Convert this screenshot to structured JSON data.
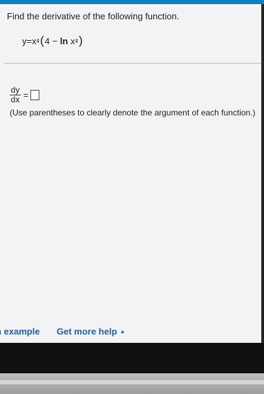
{
  "question": {
    "prompt": "Find the derivative of the following function.",
    "function": {
      "lhs": "y",
      "eq": "=",
      "base": "x",
      "exp1": "4",
      "open_paren": "(",
      "inner_const": "4",
      "minus": "−",
      "ln": "ln",
      "inner_base": "x",
      "exp2": "4",
      "close_paren": ")"
    }
  },
  "answer": {
    "numerator": "dy",
    "denominator": "dx",
    "equals": "=",
    "value": ""
  },
  "hint": "(Use parentheses to clearly denote the argument of each function.)",
  "footer": {
    "example_link": "n example",
    "help_link": "Get more help",
    "help_caret": "▲"
  },
  "colors": {
    "accent_bar": "#0f7fc0",
    "link": "#1f5f9e"
  }
}
